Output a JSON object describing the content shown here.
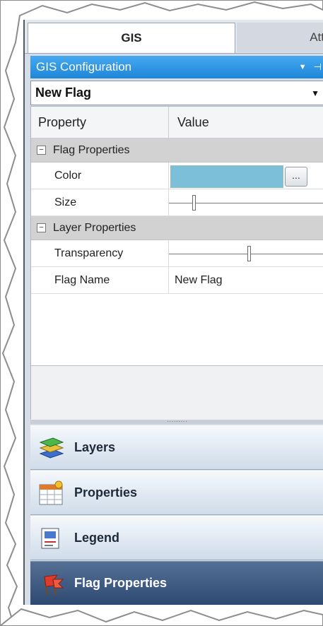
{
  "tabs": [
    {
      "label": "GIS",
      "active": true
    },
    {
      "label": "Att",
      "active": false
    }
  ],
  "panel": {
    "title": "GIS Configuration",
    "dropdown_icon": "dropdown-arrow-icon",
    "pin_icon": "pin-icon"
  },
  "selector": {
    "value": "New Flag"
  },
  "grid": {
    "headers": {
      "property": "Property",
      "value": "Value"
    },
    "categories": [
      {
        "label": "Flag Properties",
        "expanded": true
      },
      {
        "label": "Layer Properties",
        "expanded": true
      }
    ],
    "rows": [
      {
        "name": "Color",
        "value": "",
        "color": "#7cbfd8",
        "button_label": "..."
      },
      {
        "name": "Size",
        "slider_value": 0.15
      },
      {
        "name": "Transparency",
        "slider_value": 0.5
      },
      {
        "name": "Flag Name",
        "value": "New Flag"
      }
    ]
  },
  "nav": [
    {
      "label": "Layers",
      "icon": "layers-icon"
    },
    {
      "label": "Properties",
      "icon": "properties-table-icon"
    },
    {
      "label": "Legend",
      "icon": "legend-icon"
    },
    {
      "label": "Flag Properties",
      "icon": "flags-icon",
      "selected": true
    }
  ],
  "colors": {
    "title_bar": "#1e86d8",
    "selected_nav": "#2e4a72",
    "category_bg": "#d2d2d2"
  }
}
